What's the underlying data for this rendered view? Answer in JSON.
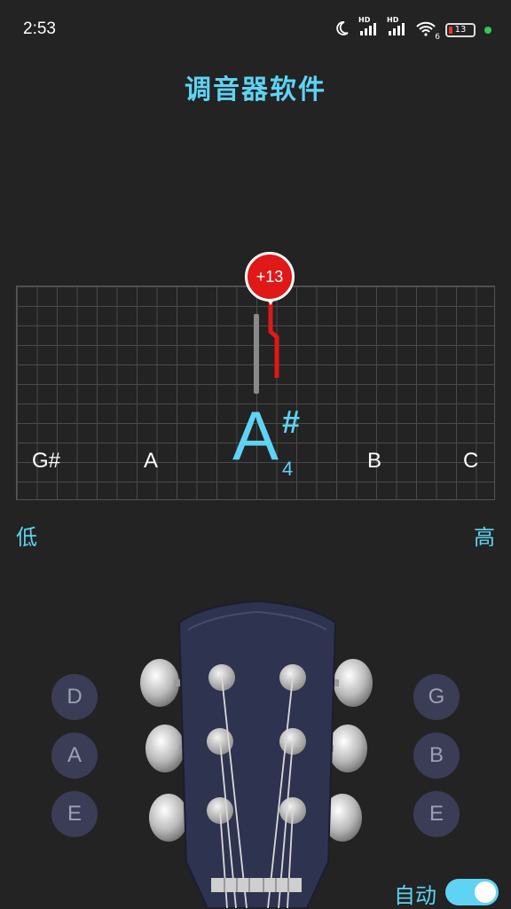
{
  "status_bar": {
    "time": "2:53",
    "hd1": "HD",
    "hd2": "HD",
    "battery": "13",
    "wifi_badge": "6"
  },
  "title": "调音器软件",
  "tuner": {
    "deviation": "+13",
    "note": "A",
    "accidental": "#",
    "octave": "4",
    "neighbor_notes": [
      "G#",
      "A",
      "B",
      "C"
    ],
    "low_label": "低",
    "high_label": "高"
  },
  "strings": {
    "left": [
      "D",
      "A",
      "E"
    ],
    "right": [
      "G",
      "B",
      "E"
    ]
  },
  "auto": {
    "label": "自动",
    "enabled": true
  },
  "colors": {
    "accent": "#5fd3f3",
    "needle": "#e01818",
    "background": "#232323",
    "headstock": "#2e3350"
  }
}
